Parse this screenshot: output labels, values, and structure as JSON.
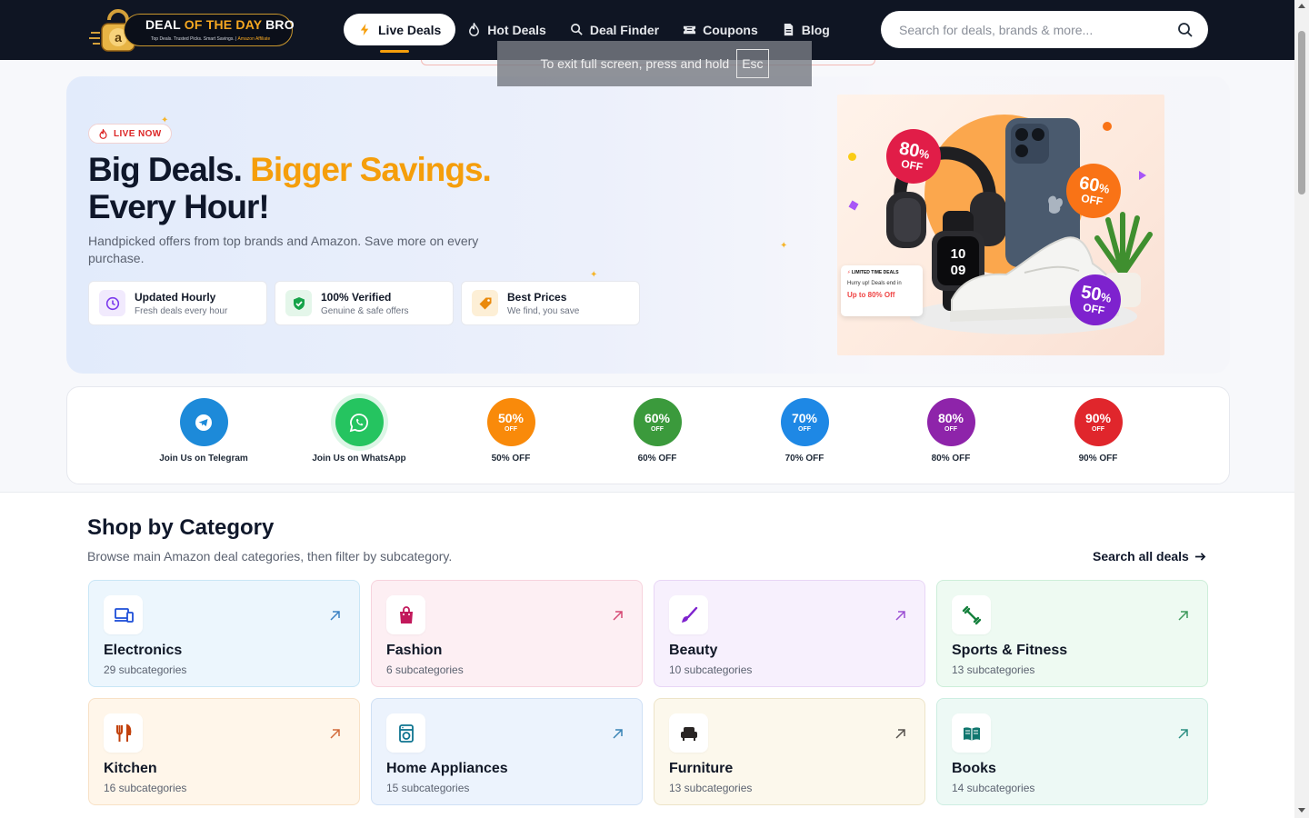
{
  "header": {
    "logo": {
      "title_main": "DEAL",
      "title_accent": "OF THE DAY",
      "title_end": "BRO",
      "tagline": "Top Deals. Trusted Picks. Smart Savings.",
      "tagline_accent": "Amazon Affiliate",
      "badge_letter": "a"
    },
    "nav": [
      {
        "label": "Live Deals",
        "icon": "bolt-icon",
        "active": true
      },
      {
        "label": "Hot Deals",
        "icon": "fire-icon"
      },
      {
        "label": "Deal Finder",
        "icon": "search-icon"
      },
      {
        "label": "Coupons",
        "icon": "ticket-icon"
      },
      {
        "label": "Blog",
        "icon": "document-icon"
      }
    ],
    "search": {
      "placeholder": "Search for deals, brands & more..."
    }
  },
  "fullscreen_toast": {
    "text": "To exit full screen, press and hold",
    "key": "Esc"
  },
  "hero": {
    "badge": "LIVE NOW",
    "title_line1_a": "Big Deals.",
    "title_line1_b": "Bigger Savings.",
    "title_line2": "Every Hour!",
    "subtitle": "Handpicked offers from top brands and Amazon. Save more on every purchase.",
    "features": [
      {
        "title": "Updated Hourly",
        "sub": "Fresh deals every hour",
        "icon": "clock-icon",
        "color": "#7c3aed",
        "bg": "#f1eafd"
      },
      {
        "title": "100% Verified",
        "sub": "Genuine & safe offers",
        "icon": "shield-check-icon",
        "color": "#16a34a",
        "bg": "#e4f6ea"
      },
      {
        "title": "Best Prices",
        "sub": "We find, you save",
        "icon": "tag-icon",
        "color": "#ea8a0c",
        "bg": "#fdefd6"
      }
    ],
    "image": {
      "bursts": [
        {
          "pct": "80",
          "unit": "%",
          "off": "OFF",
          "color": "#e11d48"
        },
        {
          "pct": "60",
          "unit": "%",
          "off": "OFF",
          "color": "#f97316"
        },
        {
          "pct": "50",
          "unit": "%",
          "off": "OFF",
          "color": "#7e22ce"
        }
      ],
      "watch_time_h": "10",
      "watch_time_m": "09",
      "limited_card": {
        "heading": "LIMITED TIME DEALS",
        "body": "Hurry up! Deals end in",
        "highlight": "Up to 80% Off"
      }
    }
  },
  "quick_links": [
    {
      "label": "Join Us on Telegram",
      "type": "icon",
      "icon": "telegram-icon",
      "color": "#1d8ad9"
    },
    {
      "label": "Join Us on WhatsApp",
      "type": "icon",
      "icon": "whatsapp-icon",
      "color": "#25c460"
    },
    {
      "label": "50% OFF",
      "type": "badge",
      "value": "50%",
      "off": "OFF",
      "color": "#f98a0a"
    },
    {
      "label": "60% OFF",
      "type": "badge",
      "value": "60%",
      "off": "OFF",
      "color": "#3b9a3c"
    },
    {
      "label": "70% OFF",
      "type": "badge",
      "value": "70%",
      "off": "OFF",
      "color": "#1e88e5"
    },
    {
      "label": "80% OFF",
      "type": "badge",
      "value": "80%",
      "off": "OFF",
      "color": "#8e24aa"
    },
    {
      "label": "90% OFF",
      "type": "badge",
      "value": "90%",
      "off": "OFF",
      "color": "#e0262c"
    }
  ],
  "categories_section": {
    "title": "Shop by Category",
    "subtitle": "Browse main Amazon deal categories, then filter by subcategory.",
    "link": "Search all deals",
    "items": [
      {
        "name": "Electronics",
        "count": "29 subcategories",
        "icon": "devices-icon",
        "color": "#1d4ed8",
        "bg": "#ecf6fd",
        "border": "#c9e6f6",
        "arrow": "#3b82c4"
      },
      {
        "name": "Fashion",
        "count": "6 subcategories",
        "icon": "shopping-bag-icon",
        "color": "#c2185b",
        "bg": "#fdeff3",
        "border": "#f7d3dd",
        "arrow": "#d64a74"
      },
      {
        "name": "Beauty",
        "count": "10 subcategories",
        "icon": "brush-icon",
        "color": "#7e22ce",
        "bg": "#f7f0fd",
        "border": "#e8d6f6",
        "arrow": "#9b4fd3"
      },
      {
        "name": "Sports & Fitness",
        "count": "13 subcategories",
        "icon": "dumbbell-icon",
        "color": "#15803d",
        "bg": "#eefaf2",
        "border": "#cdeed9",
        "arrow": "#3f9a5d"
      },
      {
        "name": "Kitchen",
        "count": "16 subcategories",
        "icon": "utensils-icon",
        "color": "#c2410c",
        "bg": "#fff6ea",
        "border": "#f8e1c6",
        "arrow": "#d26a3a"
      },
      {
        "name": "Home Appliances",
        "count": "15 subcategories",
        "icon": "washer-icon",
        "color": "#0e7490",
        "bg": "#ecf3fd",
        "border": "#cfe0f5",
        "arrow": "#3a84b6"
      },
      {
        "name": "Furniture",
        "count": "13 subcategories",
        "icon": "armchair-icon",
        "color": "#292524",
        "bg": "#fcf8ec",
        "border": "#ede4c8",
        "arrow": "#57534e"
      },
      {
        "name": "Books",
        "count": "14 subcategories",
        "icon": "book-icon",
        "color": "#0f766e",
        "bg": "#edf9f5",
        "border": "#cdeee2",
        "arrow": "#2c8f82"
      }
    ]
  }
}
